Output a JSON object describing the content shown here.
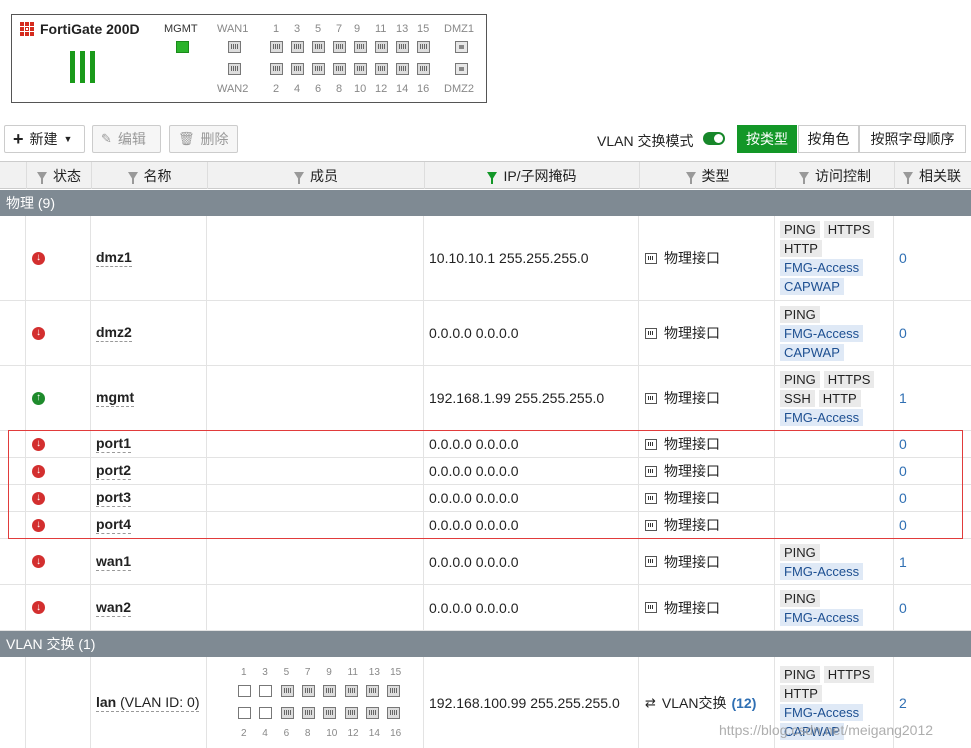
{
  "device": {
    "title": "FortiGate 200D",
    "mgmt_label": "MGMT",
    "wan1_label": "WAN1",
    "wan2_label": "WAN2",
    "dmz1_label": "DMZ1",
    "dmz2_label": "DMZ2",
    "top_port_numbers": [
      "1",
      "3",
      "5",
      "7",
      "9",
      "11",
      "13",
      "15"
    ],
    "bottom_port_numbers": [
      "2",
      "4",
      "6",
      "8",
      "10",
      "12",
      "14",
      "16"
    ]
  },
  "toolbar": {
    "new_label": "新建",
    "edit_label": "编辑",
    "delete_label": "删除",
    "vlan_mode_label": "VLAN 交换模式",
    "vlan_mode_on": true,
    "view_by_type": "按类型",
    "view_by_role": "按角色",
    "view_alpha": "按照字母顺序"
  },
  "columns": {
    "status": "状态",
    "name": "名称",
    "members": "成员",
    "ip": "IP/子网掩码",
    "type": "类型",
    "access": "访问控制",
    "ref": "相关联"
  },
  "groups": {
    "physical": "物理 (9)",
    "vlan": "VLAN 交换 (1)"
  },
  "rows": [
    {
      "status": "down",
      "name": "dmz1",
      "ip": "10.10.10.1 255.255.255.0",
      "type": "物理接口",
      "ref": "0"
    },
    {
      "status": "down",
      "name": "dmz2",
      "ip": "0.0.0.0 0.0.0.0",
      "type": "物理接口",
      "ref": "0"
    },
    {
      "status": "up",
      "name": "mgmt",
      "ip": "192.168.1.99 255.255.255.0",
      "type": "物理接口",
      "ref": "1"
    },
    {
      "status": "down",
      "name": "port1",
      "ip": "0.0.0.0 0.0.0.0",
      "type": "物理接口",
      "ref": "0"
    },
    {
      "status": "down",
      "name": "port2",
      "ip": "0.0.0.0 0.0.0.0",
      "type": "物理接口",
      "ref": "0"
    },
    {
      "status": "down",
      "name": "port3",
      "ip": "0.0.0.0 0.0.0.0",
      "type": "物理接口",
      "ref": "0"
    },
    {
      "status": "down",
      "name": "port4",
      "ip": "0.0.0.0 0.0.0.0",
      "type": "物理接口",
      "ref": "0"
    },
    {
      "status": "down",
      "name": "wan1",
      "ip": "0.0.0.0 0.0.0.0",
      "type": "物理接口",
      "ref": "1"
    },
    {
      "status": "down",
      "name": "wan2",
      "ip": "0.0.0.0 0.0.0.0",
      "type": "物理接口",
      "ref": "0"
    }
  ],
  "access": {
    "dmz1": [
      "PING",
      "HTTPS",
      "HTTP",
      "FMG-Access",
      "CAPWAP"
    ],
    "dmz2": [
      "PING",
      "FMG-Access",
      "CAPWAP"
    ],
    "mgmt": [
      "PING",
      "HTTPS",
      "SSH",
      "HTTP",
      "FMG-Access"
    ],
    "wan1": [
      "PING",
      "FMG-Access"
    ],
    "wan2": [
      "PING",
      "FMG-Access"
    ],
    "lan": [
      "PING",
      "HTTPS",
      "HTTP",
      "FMG-Access",
      "CAPWAP"
    ]
  },
  "lan": {
    "name": "lan",
    "vlan_id": "(VLAN ID: 0)",
    "ip": "192.168.100.99 255.255.255.0",
    "type": "VLAN交换",
    "type_count": "(12)",
    "ref": "2",
    "top_port_numbers": [
      "1",
      "3",
      "5",
      "7",
      "9",
      "11",
      "13",
      "15"
    ],
    "bottom_port_numbers": [
      "2",
      "4",
      "6",
      "8",
      "10",
      "12",
      "14",
      "16"
    ]
  },
  "watermark": "https://blog.csdn.net/meigang2012"
}
